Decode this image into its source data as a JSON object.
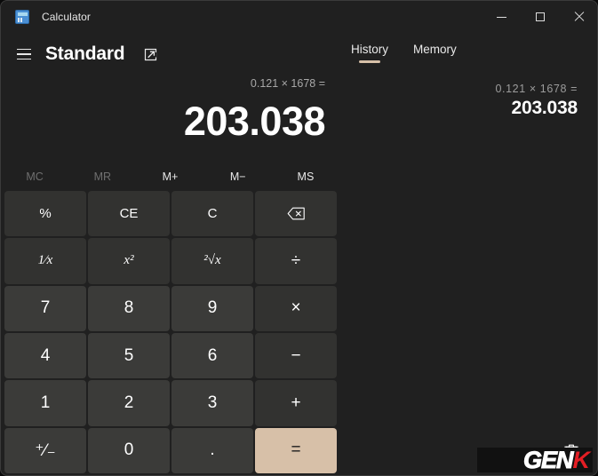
{
  "window": {
    "app_icon": "calculator-icon",
    "title": "Calculator",
    "controls": {
      "minimize": "minimize-icon",
      "maximize": "maximize-icon",
      "close": "close-icon"
    }
  },
  "header": {
    "menu_icon": "hamburger-menu-icon",
    "mode_title": "Standard",
    "keep_on_top_icon": "keep-on-top-icon"
  },
  "tabs": [
    {
      "label": "History",
      "active": true
    },
    {
      "label": "Memory",
      "active": false
    }
  ],
  "display": {
    "expression": "0.121 × 1678 =",
    "result": "203.038"
  },
  "history": {
    "items": [
      {
        "expression": "0.121  ×  1678 =",
        "result": "203.038"
      }
    ],
    "clear_icon": "trash-icon"
  },
  "memory_buttons": [
    {
      "label": "MC",
      "disabled": true
    },
    {
      "label": "MR",
      "disabled": true
    },
    {
      "label": "M+",
      "disabled": false
    },
    {
      "label": "M−",
      "disabled": false
    },
    {
      "label": "MS",
      "disabled": false
    }
  ],
  "keypad": [
    {
      "label": "%",
      "name": "percent-button",
      "kind": "fn"
    },
    {
      "label": "CE",
      "name": "clear-entry-button",
      "kind": "fn"
    },
    {
      "label": "C",
      "name": "clear-button",
      "kind": "fn"
    },
    {
      "label": "",
      "name": "backspace-button",
      "kind": "fn",
      "icon": "backspace-icon"
    },
    {
      "label": "1⁄x",
      "name": "reciprocal-button",
      "kind": "fn"
    },
    {
      "label": "x²",
      "name": "square-button",
      "kind": "fn"
    },
    {
      "label": "²√x",
      "name": "square-root-button",
      "kind": "fn"
    },
    {
      "label": "÷",
      "name": "divide-button",
      "kind": "op"
    },
    {
      "label": "7",
      "name": "seven-button",
      "kind": "num"
    },
    {
      "label": "8",
      "name": "eight-button",
      "kind": "num"
    },
    {
      "label": "9",
      "name": "nine-button",
      "kind": "num"
    },
    {
      "label": "×",
      "name": "multiply-button",
      "kind": "op"
    },
    {
      "label": "4",
      "name": "four-button",
      "kind": "num"
    },
    {
      "label": "5",
      "name": "five-button",
      "kind": "num"
    },
    {
      "label": "6",
      "name": "six-button",
      "kind": "num"
    },
    {
      "label": "−",
      "name": "subtract-button",
      "kind": "op"
    },
    {
      "label": "1",
      "name": "one-button",
      "kind": "num"
    },
    {
      "label": "2",
      "name": "two-button",
      "kind": "num"
    },
    {
      "label": "3",
      "name": "three-button",
      "kind": "num"
    },
    {
      "label": "+",
      "name": "add-button",
      "kind": "op"
    },
    {
      "label": "⁺⁄₋",
      "name": "negate-button",
      "kind": "num"
    },
    {
      "label": "0",
      "name": "zero-button",
      "kind": "num"
    },
    {
      "label": ".",
      "name": "decimal-button",
      "kind": "num"
    },
    {
      "label": "=",
      "name": "equals-button",
      "kind": "eq"
    }
  ],
  "watermark": {
    "part1": "GEN",
    "part2": "K"
  },
  "colors": {
    "background": "#202020",
    "number_key": "#3b3b39",
    "function_key": "#323230",
    "accent": "#d7c0a8",
    "text": "#ffffff",
    "muted_text": "#9c9c9c",
    "disabled_text": "#6f6f6f"
  }
}
